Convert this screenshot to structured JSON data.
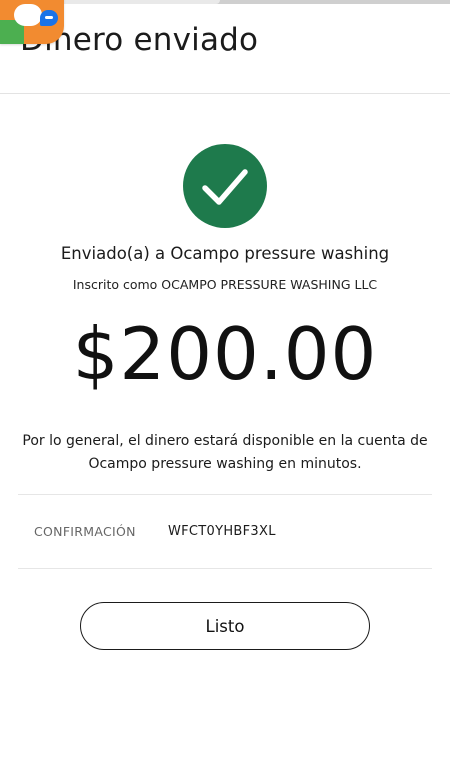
{
  "header": {
    "title": "Dinero enviado"
  },
  "status": {
    "icon": "check-icon",
    "color": "#1e7a4c"
  },
  "recipient": {
    "sent_to": "Enviado(a) a Ocampo pressure washing",
    "registered_as": "Inscrito como OCAMPO PRESSURE WASHING LLC"
  },
  "amount": "$200.00",
  "info_text": "Por lo general, el dinero estará disponible en la cuenta de Ocampo pressure washing en minutos.",
  "confirmation": {
    "label": "CONFIRMACIÓN",
    "value": "WFCT0YHBF3XL"
  },
  "actions": {
    "done_label": "Listo"
  },
  "overlay": {
    "icon": "chat-bubble-icon",
    "color": "#f28b30"
  }
}
